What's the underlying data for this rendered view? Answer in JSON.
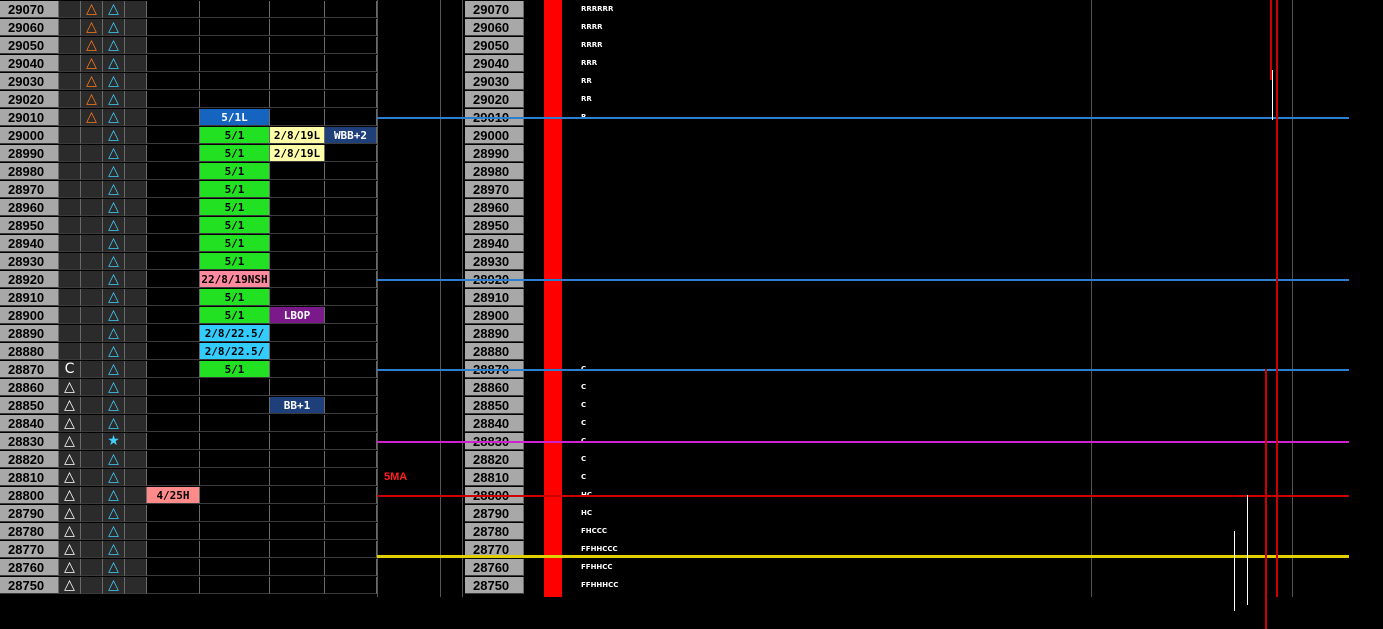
{
  "prices": [
    "29070",
    "29060",
    "29050",
    "29040",
    "29030",
    "29020",
    "29010",
    "29000",
    "28990",
    "28980",
    "28970",
    "28960",
    "28950",
    "28940",
    "28930",
    "28920",
    "28910",
    "28900",
    "28890",
    "28880",
    "28870",
    "28860",
    "28850",
    "28840",
    "28830",
    "28820",
    "28810",
    "28800",
    "28790",
    "28780",
    "28770",
    "28760",
    "28750"
  ],
  "col1_symbols": [
    "",
    "",
    "",
    "",
    "",
    "",
    "",
    "",
    "",
    "",
    "",
    "",
    "",
    "",
    "",
    "",
    "",
    "",
    "",
    "",
    "C",
    "△",
    "△",
    "△",
    "△",
    "△",
    "△",
    "△",
    "△",
    "△",
    "△",
    "△",
    "△"
  ],
  "col2_symbols": [
    "△",
    "△",
    "△",
    "△",
    "△",
    "△",
    "△",
    "",
    "",
    "",
    "",
    "",
    "",
    "",
    "",
    "",
    "",
    "",
    "",
    "",
    "",
    "",
    "",
    "",
    "",
    "",
    "",
    "",
    "",
    "",
    "",
    "",
    ""
  ],
  "col3_symbols": [
    "△",
    "△",
    "△",
    "△",
    "△",
    "△",
    "△",
    "△",
    "△",
    "△",
    "△",
    "△",
    "△",
    "△",
    "△",
    "△",
    "△",
    "△",
    "△",
    "△",
    "△",
    "△",
    "△",
    "△",
    "★",
    "△",
    "△",
    "△",
    "△",
    "△",
    "△",
    "△",
    "△"
  ],
  "tags": [
    {
      "row": 6,
      "col": "c6",
      "text": "5/1L",
      "bg": "#1565c0",
      "fg": "#ffffff"
    },
    {
      "row": 7,
      "col": "c6",
      "text": "5/1",
      "bg": "#22e022",
      "fg": "#000000"
    },
    {
      "row": 8,
      "col": "c6",
      "text": "5/1",
      "bg": "#22e022",
      "fg": "#000000"
    },
    {
      "row": 9,
      "col": "c6",
      "text": "5/1",
      "bg": "#22e022",
      "fg": "#000000"
    },
    {
      "row": 10,
      "col": "c6",
      "text": "5/1",
      "bg": "#22e022",
      "fg": "#000000"
    },
    {
      "row": 11,
      "col": "c6",
      "text": "5/1",
      "bg": "#22e022",
      "fg": "#000000"
    },
    {
      "row": 12,
      "col": "c6",
      "text": "5/1",
      "bg": "#22e022",
      "fg": "#000000"
    },
    {
      "row": 13,
      "col": "c6",
      "text": "5/1",
      "bg": "#22e022",
      "fg": "#000000"
    },
    {
      "row": 14,
      "col": "c6",
      "text": "5/1",
      "bg": "#22e022",
      "fg": "#000000"
    },
    {
      "row": 15,
      "col": "c6",
      "text": "22/8/19NSH",
      "bg": "#ff8aa0",
      "fg": "#000000"
    },
    {
      "row": 16,
      "col": "c6",
      "text": "5/1",
      "bg": "#22e022",
      "fg": "#000000"
    },
    {
      "row": 17,
      "col": "c6",
      "text": "5/1",
      "bg": "#22e022",
      "fg": "#000000"
    },
    {
      "row": 18,
      "col": "c6",
      "text": "2/8/22.5/",
      "bg": "#33ccff",
      "fg": "#000000"
    },
    {
      "row": 19,
      "col": "c6",
      "text": "2/8/22.5/",
      "bg": "#33ccff",
      "fg": "#000000"
    },
    {
      "row": 20,
      "col": "c6",
      "text": "5/1",
      "bg": "#22e022",
      "fg": "#000000"
    },
    {
      "row": 7,
      "col": "c7",
      "text": "2/8/19L",
      "bg": "#ffffaa",
      "fg": "#000000"
    },
    {
      "row": 8,
      "col": "c7",
      "text": "2/8/19L",
      "bg": "#ffffaa",
      "fg": "#000000"
    },
    {
      "row": 7,
      "col": "c8",
      "text": "WBB+2",
      "bg": "#1f3f7a",
      "fg": "#ffffff"
    },
    {
      "row": 17,
      "col": "c7",
      "text": "LBOP",
      "bg": "#7a1a8a",
      "fg": "#ffffff"
    },
    {
      "row": 22,
      "col": "c7",
      "text": "BB+1",
      "bg": "#1f3f7a",
      "fg": "#ffffff"
    },
    {
      "row": 27,
      "col": "c5",
      "text": "4/25H",
      "bg": "#ff8a8a",
      "fg": "#000000"
    }
  ],
  "tpo_letters": [
    "RRRRRR",
    "RRRR",
    "RRRR",
    "RRR",
    "RR",
    "RR",
    "R",
    "",
    "",
    "",
    "",
    "",
    "",
    "",
    "",
    "",
    "",
    "",
    "",
    "",
    "C",
    "C",
    "C",
    "C",
    "C",
    "C",
    "C",
    "HC",
    "HC",
    "FHCCC",
    "FFHHCCC",
    "FFHHCC",
    "FFHHHCC"
  ],
  "ma_label": "5MA",
  "colors": {
    "price_bg": "#a8a8a8",
    "red_bar": "#ff0000",
    "blue_line": "#2a7fd0",
    "magenta_line": "#d020d0",
    "red_line": "#cc0000",
    "yellow_line": "#e0d000"
  }
}
